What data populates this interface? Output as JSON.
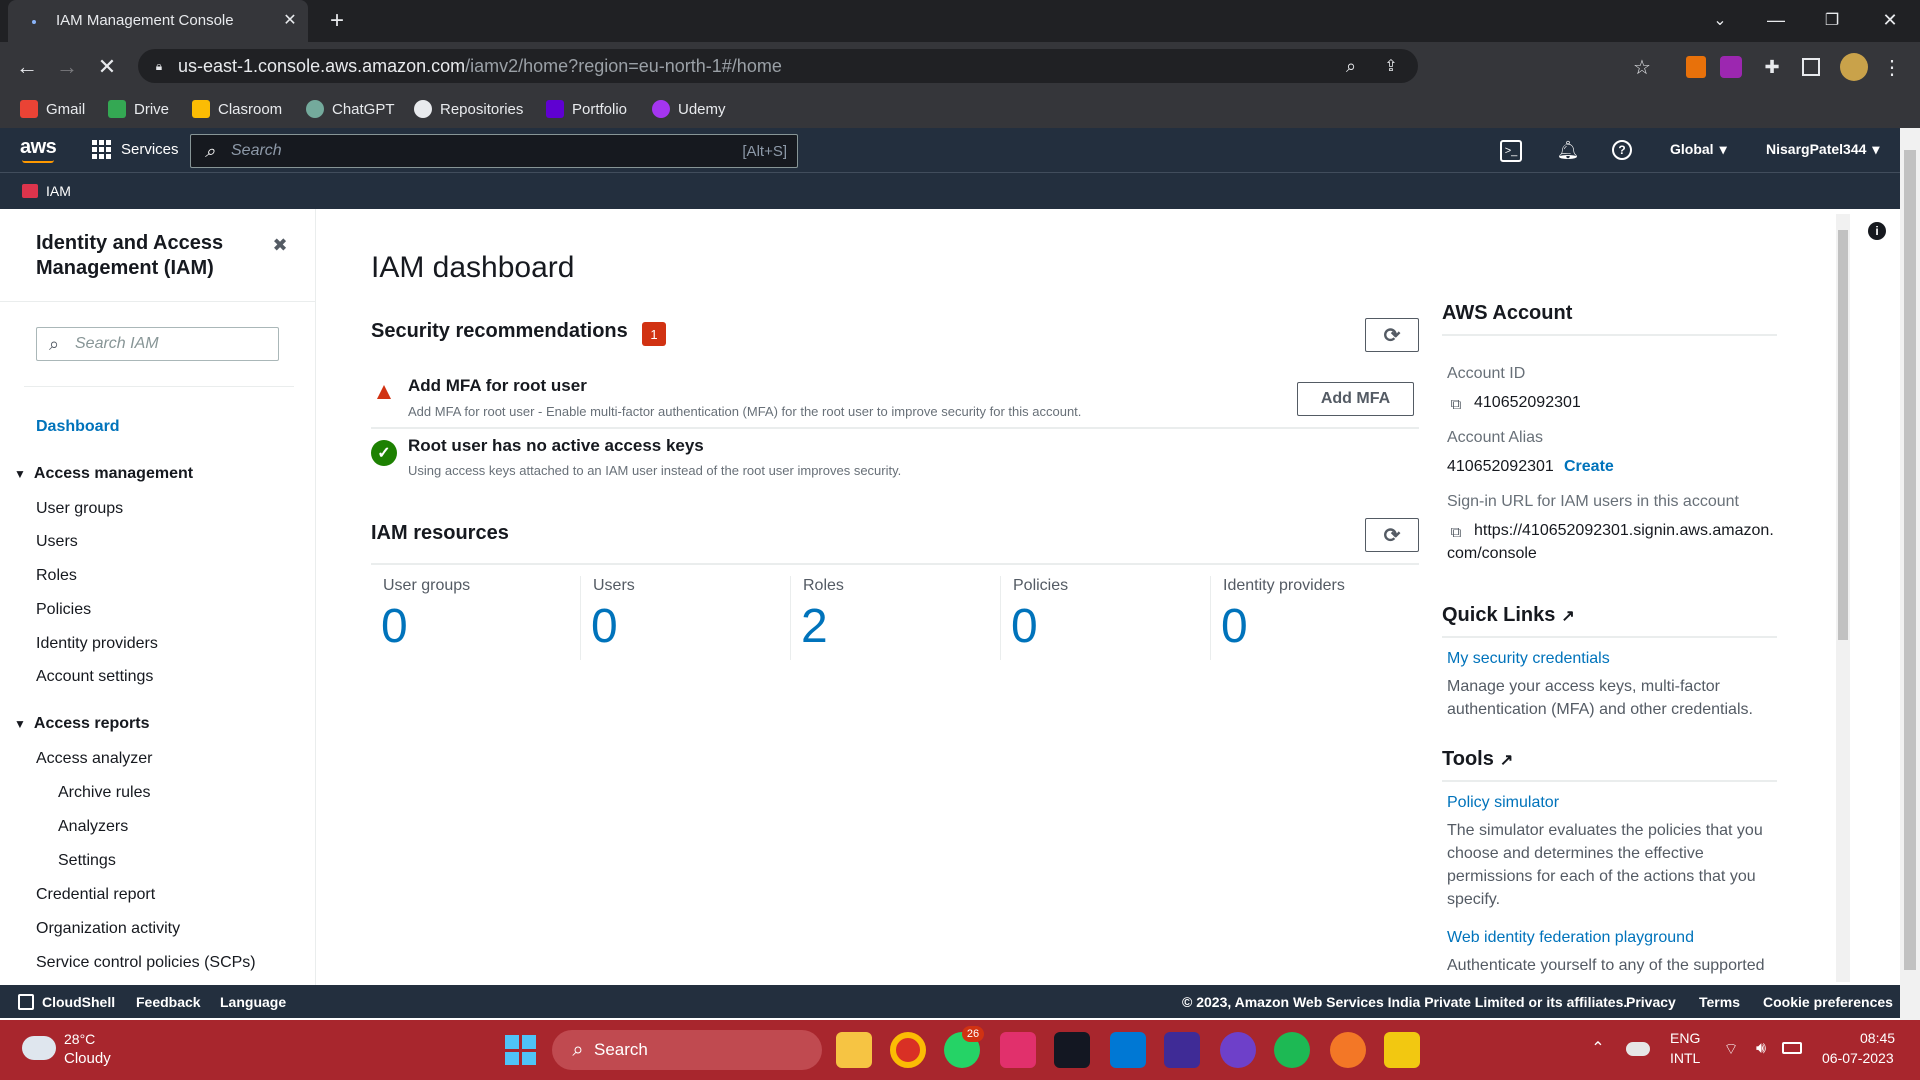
{
  "browser": {
    "tab_title": "IAM Management Console",
    "url_host": "us-east-1.console.aws.amazon.com",
    "url_path": "/iamv2/home?region=eu-north-1#/home",
    "bookmarks": [
      "Gmail",
      "Drive",
      "Clasroom",
      "ChatGPT",
      "Repositories",
      "Portfolio",
      "Udemy"
    ]
  },
  "awsnav": {
    "logo": "aws",
    "services": "Services",
    "search_placeholder": "Search",
    "search_shortcut": "[Alt+S]",
    "region": "Global",
    "user": "NisargPatel344",
    "service_tag": "IAM"
  },
  "sidebar": {
    "title": "Identity and Access Management (IAM)",
    "search_placeholder": "Search IAM",
    "dashboard": "Dashboard",
    "access_management": "Access management",
    "am_items": [
      "User groups",
      "Users",
      "Roles",
      "Policies",
      "Identity providers",
      "Account settings"
    ],
    "access_reports": "Access reports",
    "ar_items": [
      "Access analyzer",
      "Archive rules",
      "Analyzers",
      "Settings",
      "Credential report",
      "Organization activity",
      "Service control policies (SCPs)"
    ]
  },
  "main": {
    "title": "IAM dashboard",
    "security_title": "Security recommendations",
    "security_badge": "1",
    "rec1_title": "Add MFA for root user",
    "rec1_desc": "Add MFA for root user - Enable multi-factor authentication (MFA) for the root user to improve security for this account.",
    "rec1_button": "Add MFA",
    "rec2_title": "Root user has no active access keys",
    "rec2_desc": "Using access keys attached to an IAM user instead of the root user improves security.",
    "resources_title": "IAM resources",
    "resources": [
      {
        "label": "User groups",
        "value": "0"
      },
      {
        "label": "Users",
        "value": "0"
      },
      {
        "label": "Roles",
        "value": "2"
      },
      {
        "label": "Policies",
        "value": "0"
      },
      {
        "label": "Identity providers",
        "value": "0"
      }
    ]
  },
  "account": {
    "title": "AWS Account",
    "id_label": "Account ID",
    "id_value": "410652092301",
    "alias_label": "Account Alias",
    "alias_value": "410652092301",
    "alias_create": "Create",
    "signin_label": "Sign-in URL for IAM users in this account",
    "signin_line1": "https://410652092301.signin.aws.amazon.",
    "signin_line2": "com/console",
    "quicklinks_title": "Quick Links",
    "ql_link": "My security credentials",
    "ql_desc1": "Manage your access keys, multi-factor",
    "ql_desc2": "authentication (MFA) and other credentials.",
    "tools_title": "Tools",
    "tool1_link": "Policy simulator",
    "tool1_desc": [
      "The simulator evaluates the policies that you",
      "choose and determines the effective",
      "permissions for each of the actions that you",
      "specify."
    ],
    "tool2_link": "Web identity federation playground",
    "tool2_desc": "Authenticate yourself to any of the supported"
  },
  "footer": {
    "cloudshell": "CloudShell",
    "feedback": "Feedback",
    "language": "Language",
    "copyright": "© 2023, Amazon Web Services India Private Limited or its affiliates.",
    "privacy": "Privacy",
    "terms": "Terms",
    "cookies": "Cookie preferences"
  },
  "taskbar": {
    "weather_temp": "28°C",
    "weather_desc": "Cloudy",
    "search": "Search",
    "whatsapp_badge": "26",
    "lang1": "ENG",
    "lang2": "INTL",
    "time": "08:45",
    "date": "06-07-2023"
  },
  "colors": {
    "aws_nav": "#232f3e",
    "accent": "#0073bb",
    "badge": "#d13212",
    "taskbar": "#a8262d"
  }
}
